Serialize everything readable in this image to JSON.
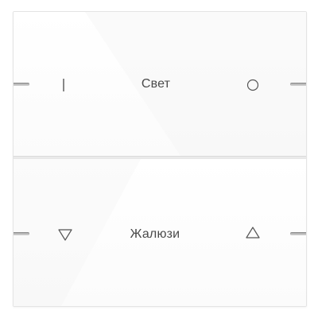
{
  "rockers": {
    "top": {
      "label": "Свет",
      "left_symbol": "on-line-icon",
      "right_symbol": "off-circle-icon"
    },
    "bottom": {
      "label": "Жалюзи",
      "left_symbol": "down-triangle-icon",
      "right_symbol": "up-triangle-icon"
    }
  },
  "colors": {
    "panel": "#fcfcfc",
    "text": "#4a4a4a",
    "led": "#b8b8b8"
  }
}
